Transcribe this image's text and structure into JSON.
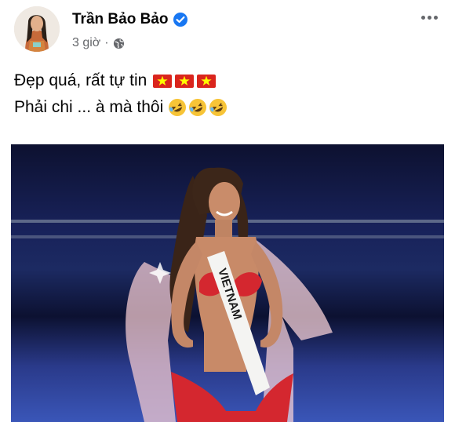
{
  "post": {
    "author": "Trần Bảo Bảo",
    "time": "3 giờ",
    "separator": "·",
    "lines": [
      "Đẹp quá, rất tự tin",
      "Phải chi ... à mà thôi"
    ],
    "icons": {
      "verified": "verified-badge-icon",
      "audience": "globe-icon",
      "more": "more-options-icon",
      "flag": "vietnam-flag-icon",
      "laugh": "rolling-laughing-emoji-icon"
    },
    "photo_sash_text": "VIETNAM"
  },
  "colors": {
    "verified": "#1877f2",
    "secondary_text": "#65676b",
    "flag_red": "#da251d",
    "flag_star": "#ffff00"
  }
}
